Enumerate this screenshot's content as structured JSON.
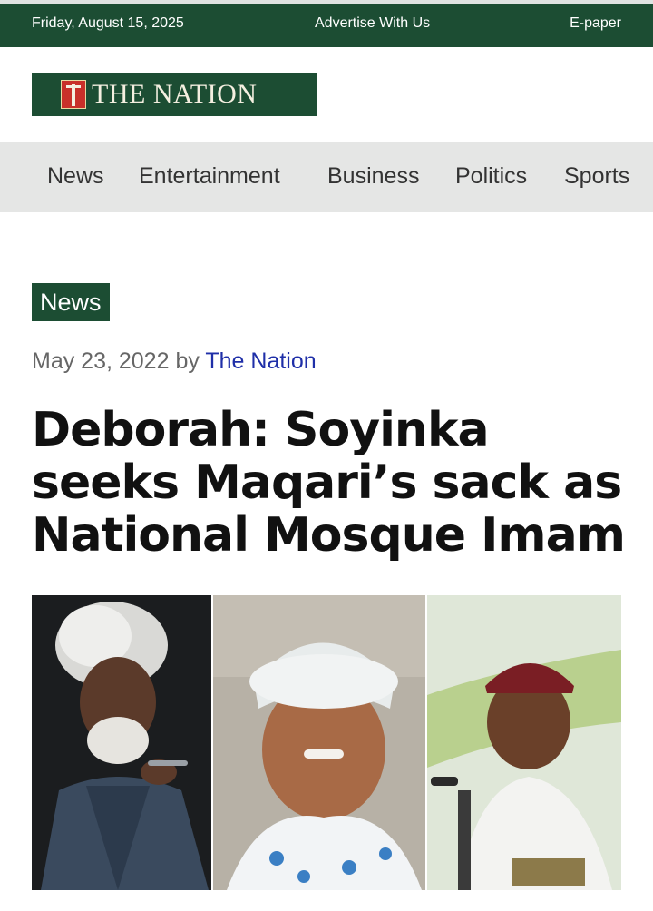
{
  "topbar": {
    "date": "Friday, August 15, 2025",
    "advertise": "Advertise With Us",
    "epaper": "E-paper"
  },
  "brand": {
    "logo_text": "THE NATION"
  },
  "nav": {
    "items": [
      "News",
      "Entertainment",
      "Business",
      "Politics",
      "Sports"
    ]
  },
  "article": {
    "category": "News",
    "date": "May 23, 2022",
    "by": "by",
    "author": "The Nation",
    "headline": "Deborah: Soyinka seeks Maqari’s sack as National Mosque Imam"
  },
  "colors": {
    "brand_green": "#1c4d33",
    "nav_bg": "#e5e6e5",
    "author_link": "#1f2fa8"
  }
}
